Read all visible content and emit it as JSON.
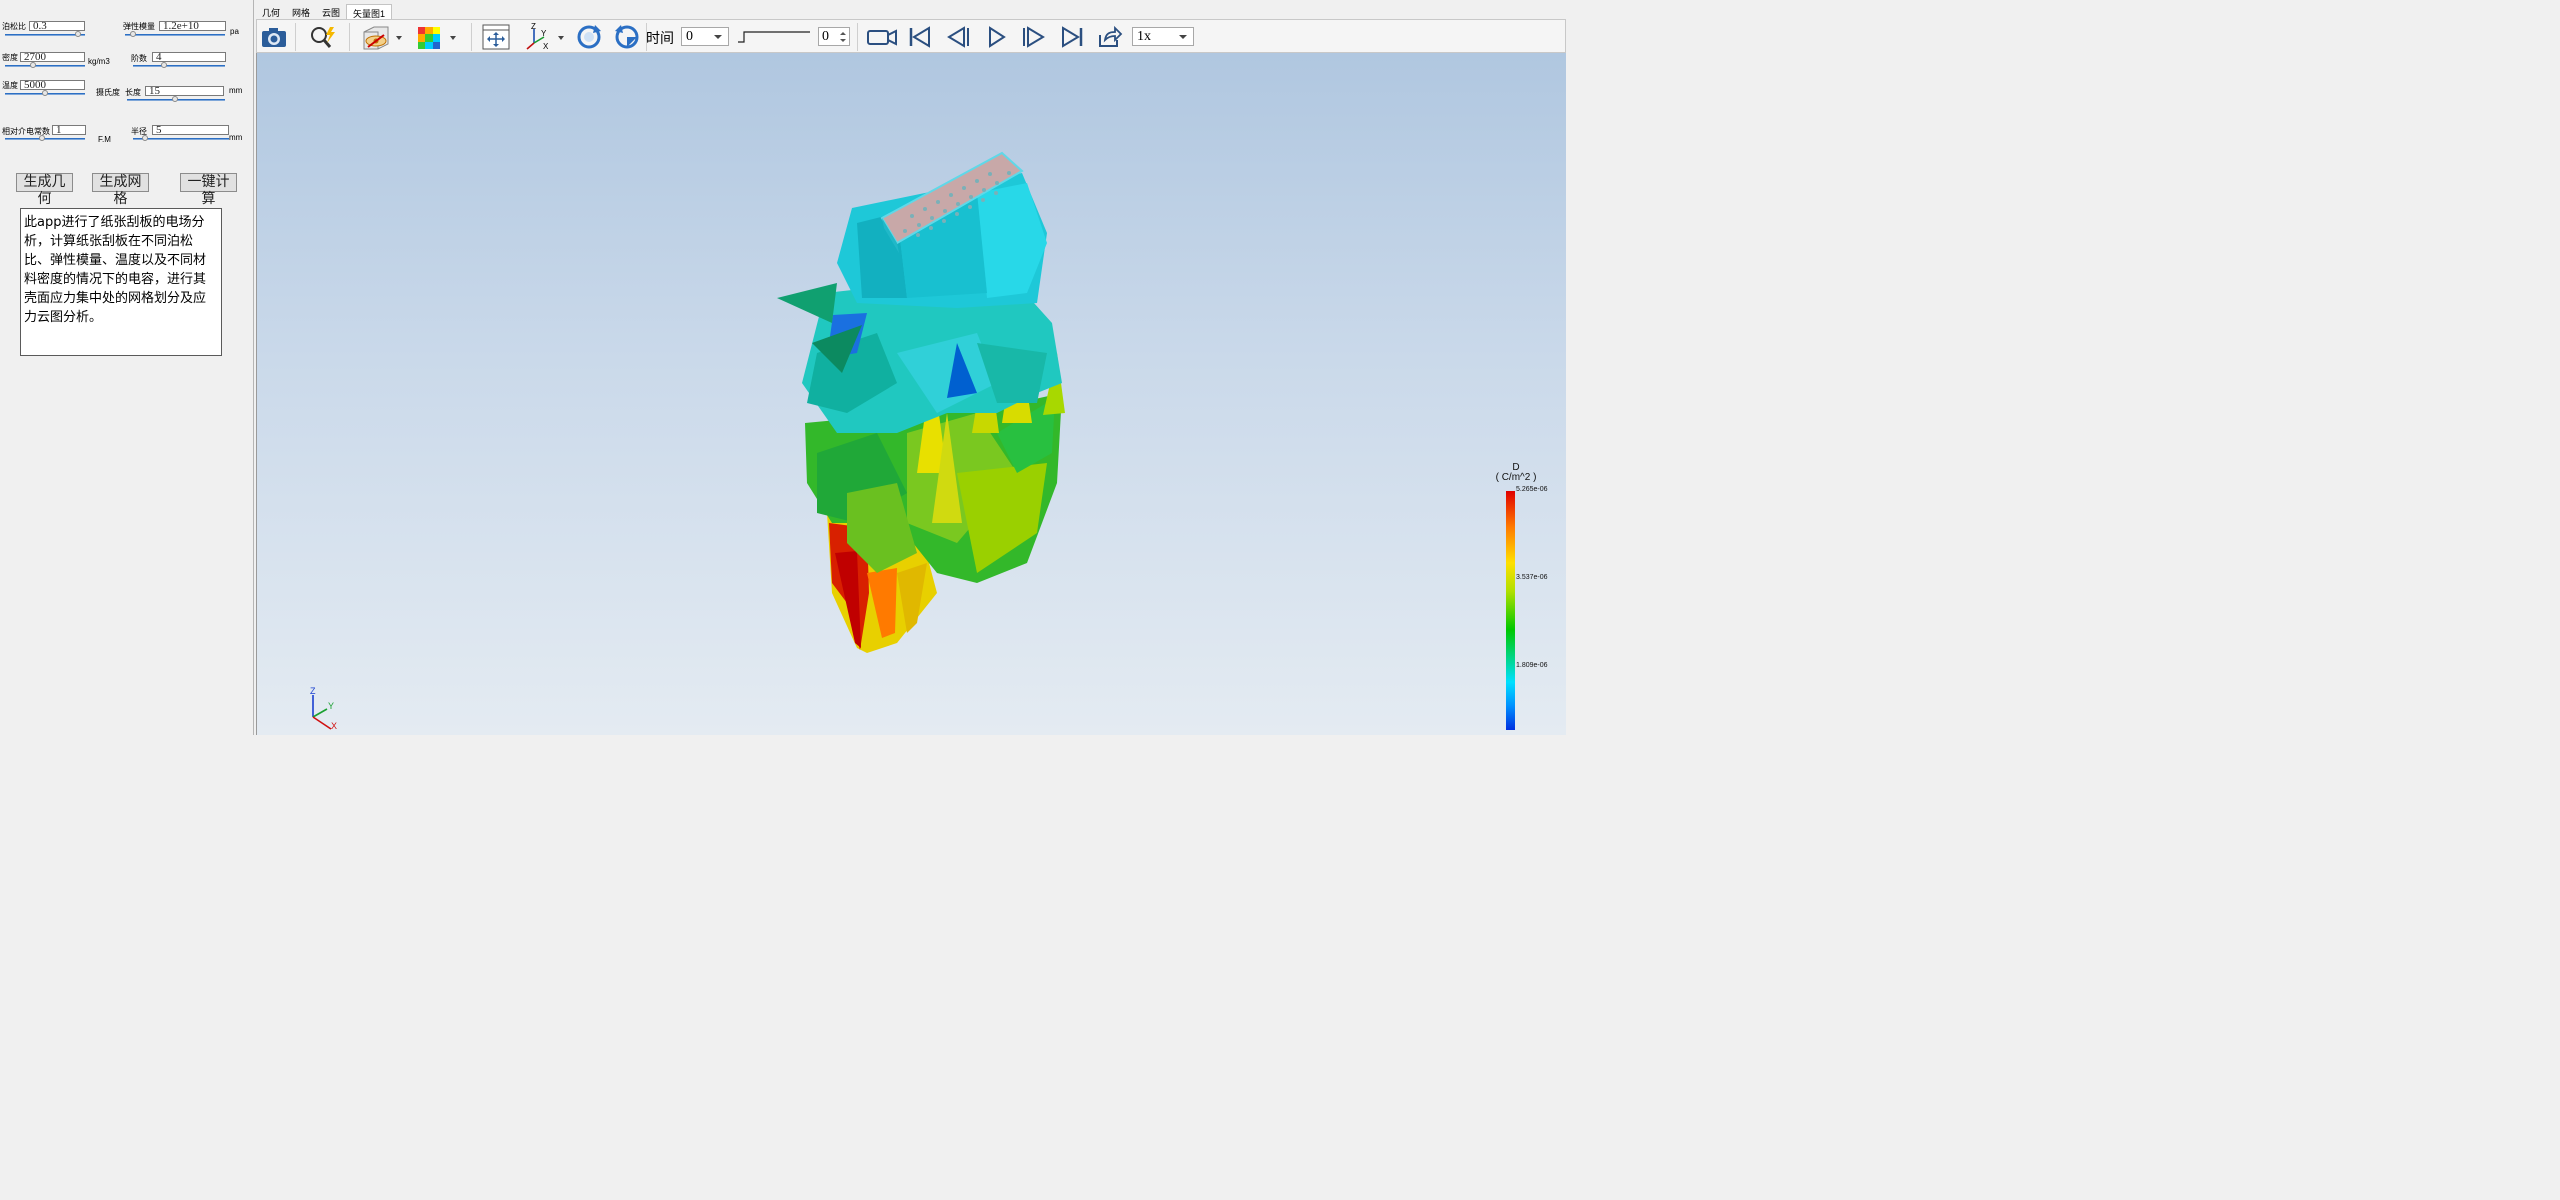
{
  "params": {
    "poisson": {
      "label": "泊松比",
      "value": "0.3"
    },
    "modulus": {
      "label": "弹性模量",
      "value": "1.2e+10",
      "unit": "pa"
    },
    "density": {
      "label": "密度",
      "value": "2700",
      "unit": "kg/m3"
    },
    "order": {
      "label": "阶数",
      "value": "4"
    },
    "temperature": {
      "label": "温度",
      "value": "5000"
    },
    "celsius": {
      "label": "摄氏度"
    },
    "length": {
      "label": "长度",
      "value": "15",
      "unit": "mm"
    },
    "permittivity": {
      "label": "相对介电常数",
      "value": "1",
      "unit": "F.M"
    },
    "radius": {
      "label": "半径",
      "value": "5",
      "unit": "mm"
    }
  },
  "buttons": {
    "geometry": "生成几何",
    "mesh": "生成网格",
    "compute": "一键计算"
  },
  "description": "此app进行了纸张刮板的电场分析，计算纸张刮板在不同泊松比、弹性模量、温度以及不同材料密度的情况下的电容，进行其壳面应力集中处的网格划分及应力云图分析。",
  "tabs": [
    "几何",
    "网格",
    "云图",
    "矢量图1"
  ],
  "toolbar": {
    "time_label": "时间",
    "time_value": "0",
    "frame_value": "0",
    "speed_value": "1x",
    "icons": [
      "camera-icon",
      "zoom-icon",
      "visibility-icon",
      "colormap-icon",
      "fit-view-icon",
      "axes-icon",
      "rotate-cw-icon",
      "rotate-ccw-icon",
      "record-icon",
      "first-frame-icon",
      "prev-frame-icon",
      "play-icon",
      "next-frame-icon",
      "last-frame-icon",
      "export-icon"
    ]
  },
  "legend": {
    "title_line1": "D",
    "title_line2": "( C/m^2 )",
    "max": "5.265e-06",
    "mid": "3.537e-06",
    "low": "1.809e-06",
    "colors": [
      "#e00000",
      "#ffe000",
      "#00c800",
      "#00e0ff",
      "#0030e0"
    ]
  },
  "axes": {
    "z": "Z",
    "y": "Y",
    "x": "X"
  }
}
